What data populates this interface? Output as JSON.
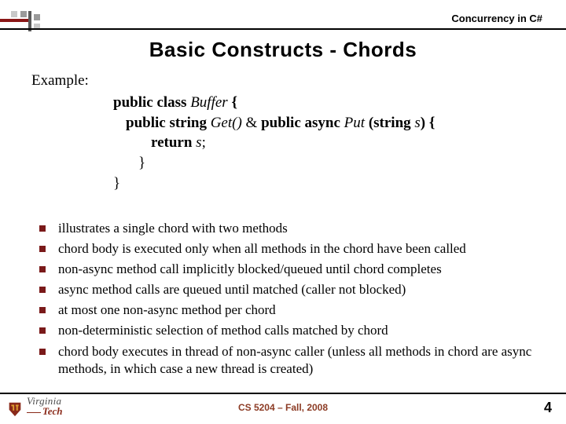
{
  "header": {
    "label": "Concurrency in C#"
  },
  "title": "Basic Constructs - Chords",
  "example_label": "Example:",
  "code": {
    "l1_a": "public class ",
    "l1_b": "Buffer",
    "l1_c": " {",
    "l2_a": "public string ",
    "l2_b": "Get()",
    "l2_c": " & ",
    "l2_d": "public async ",
    "l2_e": "Put ",
    "l2_f": "(",
    "l2_g": "string ",
    "l2_h": "s",
    "l2_i": ") {",
    "l3_a": "return ",
    "l3_b": "s",
    "l3_c": ";",
    "l4": "}",
    "l5": "}"
  },
  "bullets": [
    "illustrates a single chord with two methods",
    "chord body is executed only when all methods in the chord have been called",
    "non-async method call implicitly blocked/queued until chord completes",
    "async method calls are queued until matched (caller not blocked)",
    "at most one non-async method per chord",
    "non-deterministic selection of method calls matched by chord",
    "chord body executes in thread of non-async caller (unless all methods in chord are async methods, in which case a new thread is created)"
  ],
  "footer": {
    "logo_line1": "Virginia",
    "logo_line2": "Tech",
    "center": "CS 5204 – Fall, 2008",
    "page": "4"
  }
}
